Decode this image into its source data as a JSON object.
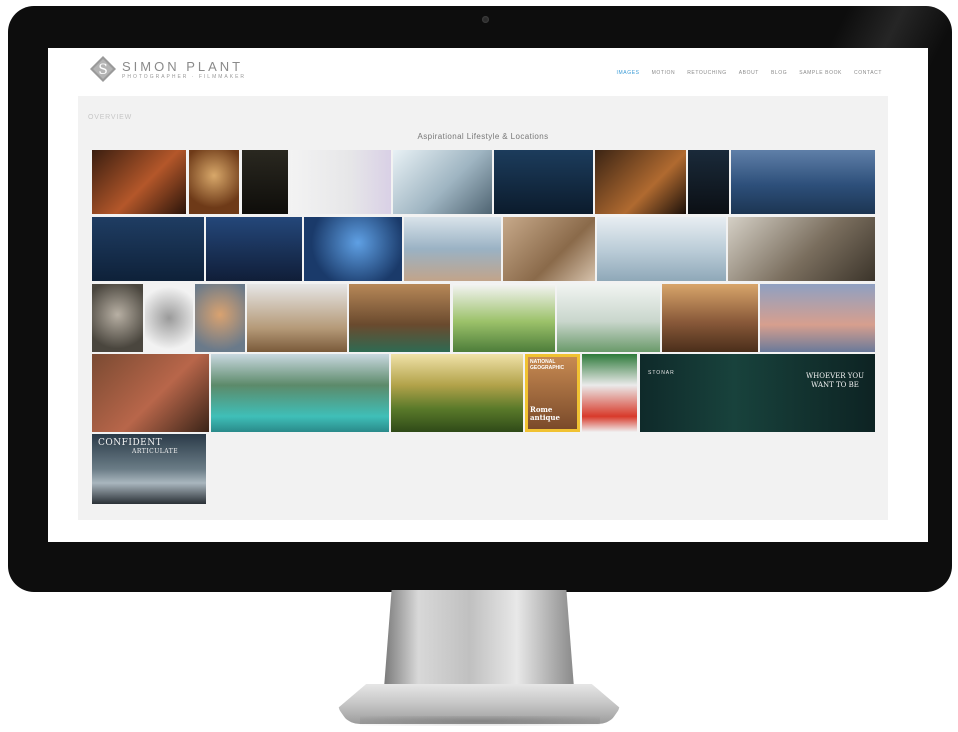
{
  "site": {
    "brand": {
      "name": "SIMON PLANT",
      "tagline": "PHOTOGRAPHER · FILMMAKER",
      "mark": "S"
    },
    "nav": [
      {
        "label": "IMAGES",
        "active": true
      },
      {
        "label": "MOTION",
        "active": false
      },
      {
        "label": "RETOUCHING",
        "active": false
      },
      {
        "label": "ABOUT",
        "active": false
      },
      {
        "label": "BLOG",
        "active": false
      },
      {
        "label": "SAMPLE BOOK",
        "active": false
      },
      {
        "label": "CONTACT",
        "active": false
      }
    ],
    "accent": "#3a9bd6"
  },
  "page": {
    "overview": "OVERVIEW",
    "gallery_title": "Aspirational Lifestyle & Locations"
  },
  "covers": {
    "natgeo": {
      "title": "NATIONAL GEOGRAPHIC",
      "headline": "Rome antique"
    },
    "stonar": {
      "brand": "STONAR",
      "headline": "WHOEVER YOU WANT TO BE"
    },
    "confident": {
      "title": "CONFIDENT",
      "subtitle": "ARTICULATE"
    }
  }
}
